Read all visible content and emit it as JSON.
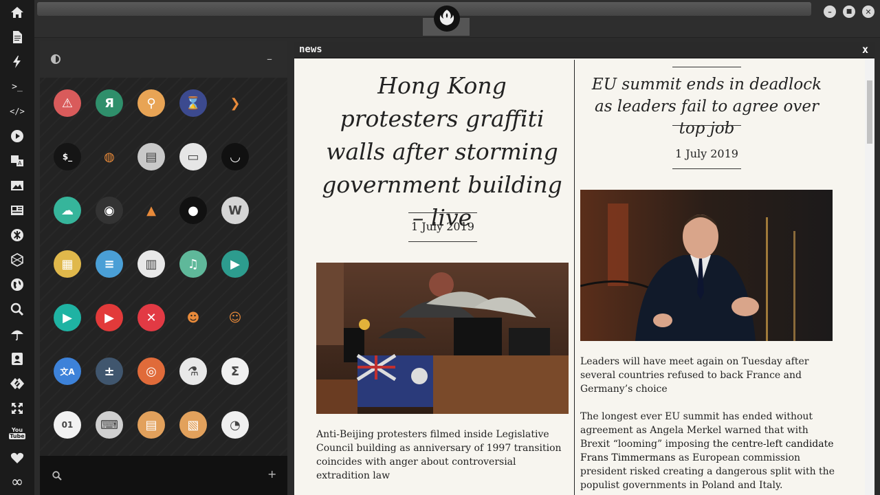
{
  "sidebar": {
    "items": [
      {
        "icon": "home-icon",
        "glyph": "⌂"
      },
      {
        "icon": "document-icon",
        "glyph": ""
      },
      {
        "icon": "lightning-icon",
        "glyph": "ϟ"
      },
      {
        "icon": "terminal-icon",
        "glyph": ">_"
      },
      {
        "icon": "code-icon",
        "glyph": "</>"
      },
      {
        "icon": "play-icon",
        "glyph": "▶"
      },
      {
        "icon": "translate-icon",
        "glyph": "A"
      },
      {
        "icon": "image-icon",
        "glyph": ""
      },
      {
        "icon": "news-icon",
        "glyph": ""
      },
      {
        "icon": "asterisk-icon",
        "glyph": "✱"
      },
      {
        "icon": "hexagon-icon",
        "glyph": "⬡"
      },
      {
        "icon": "globe-icon",
        "glyph": "●"
      },
      {
        "icon": "search-icon",
        "glyph": ""
      },
      {
        "icon": "umbrella-icon",
        "glyph": "☂"
      },
      {
        "icon": "contact-icon",
        "glyph": ""
      },
      {
        "icon": "link-icon",
        "glyph": "◇"
      },
      {
        "icon": "expand-icon",
        "glyph": "✕"
      },
      {
        "icon": "youtube-icon",
        "glyph": "You Tube"
      },
      {
        "icon": "heart-icon",
        "glyph": "♥"
      },
      {
        "icon": "infinity-icon",
        "glyph": "∞"
      }
    ]
  },
  "window_controls": {
    "minimize": "–",
    "maximize": "■",
    "close": "✕"
  },
  "launcher": {
    "minimize_label": "–",
    "add_label": "+",
    "apps": [
      {
        "name": "warning-app",
        "glyph": "⚠",
        "bg": "#d95b5b"
      },
      {
        "name": "yandex-app",
        "glyph": "Я",
        "bg": "#2f8f6b"
      },
      {
        "name": "search-app",
        "glyph": "⚲",
        "bg": "#e8a455"
      },
      {
        "name": "hourglass-app",
        "glyph": "⌛",
        "bg": "#3c4a8f"
      },
      {
        "name": "arrow-app",
        "glyph": "❯",
        "bg": "transparent"
      },
      {
        "name": "terminal-app",
        "glyph": "$_",
        "bg": "#151515"
      },
      {
        "name": "globe-app",
        "glyph": "◍",
        "bg": "transparent"
      },
      {
        "name": "scanner-app",
        "glyph": "▤",
        "bg": "#c9c9c9"
      },
      {
        "name": "window-app",
        "glyph": "▭",
        "bg": "#e6e6e6"
      },
      {
        "name": "mask-app",
        "glyph": "◡",
        "bg": "#111"
      },
      {
        "name": "cloud-lock-app",
        "glyph": "☁",
        "bg": "#36b59b"
      },
      {
        "name": "github-app",
        "glyph": "◉",
        "bg": "#333"
      },
      {
        "name": "starfleet-app",
        "glyph": "▲",
        "bg": "transparent"
      },
      {
        "name": "death-star-app",
        "glyph": "●",
        "bg": "#111"
      },
      {
        "name": "wikipedia-app",
        "glyph": "W",
        "bg": "#d5d5d5"
      },
      {
        "name": "world-map-app",
        "glyph": "▦",
        "bg": "#e0b84b"
      },
      {
        "name": "books-app",
        "glyph": "≡",
        "bg": "#4a9fd6"
      },
      {
        "name": "notes-app",
        "glyph": "▥",
        "bg": "#e8e8e8"
      },
      {
        "name": "music-app",
        "glyph": "♫",
        "bg": "#5fb89a"
      },
      {
        "name": "video-app",
        "glyph": "▶",
        "bg": "#2d9c8e"
      },
      {
        "name": "player-app",
        "glyph": "▶",
        "bg": "#1fb3a3"
      },
      {
        "name": "youtube-app",
        "glyph": "▶",
        "bg": "#e23a3a"
      },
      {
        "name": "cancel-app",
        "glyph": "✕",
        "bg": "#e23a44"
      },
      {
        "name": "iron-man-app",
        "glyph": "☻",
        "bg": "transparent"
      },
      {
        "name": "c3po-app",
        "glyph": "☺",
        "bg": "transparent"
      },
      {
        "name": "translate-app",
        "glyph": "文A",
        "bg": "#3d82d9"
      },
      {
        "name": "calculator-app",
        "glyph": "±",
        "bg": "#40566e"
      },
      {
        "name": "camera-app",
        "glyph": "◎",
        "bg": "#e06b3a"
      },
      {
        "name": "lab-app",
        "glyph": "⚗",
        "bg": "#e8e8e8"
      },
      {
        "name": "formula-app",
        "glyph": "Σ",
        "bg": "#f0f0f0"
      },
      {
        "name": "binary-app",
        "glyph": "01",
        "bg": "#f2f2f2"
      },
      {
        "name": "keyboard-app",
        "glyph": "⌨",
        "bg": "#d0d0d0"
      },
      {
        "name": "text-editor-app",
        "glyph": "▤",
        "bg": "#e2a15c"
      },
      {
        "name": "image-viewer-app",
        "glyph": "▧",
        "bg": "#e2a15c"
      },
      {
        "name": "presentation-app",
        "glyph": "◔",
        "bg": "#f0f0f0"
      }
    ]
  },
  "news": {
    "title": "news",
    "close_label": "x",
    "left_article": {
      "headline": "Hong Kong protesters graffiti walls after storming government building – live",
      "date": "1 July 2019",
      "summary": "Anti-Beijing protesters filmed inside Legislative Council building as anniversary of 1997 transition coincides with anger about controversial extradition law"
    },
    "right_article": {
      "headline": "EU summit ends in deadlock as leaders fail to agree over top job",
      "date": "1 July 2019",
      "summary": "Leaders will have meet again on Tuesday after several countries refused to back France and Germany’s choice",
      "body_start": "The longest ever EU summit has ended without agreement as Angela Merkel warned that with Brexit “looming” imposing ",
      "body_link": "the centre-left candidate Frans Timmermans",
      "body_end": " as European commission president risked creating a dangerous split with the populist governments in Poland and Italy."
    }
  }
}
